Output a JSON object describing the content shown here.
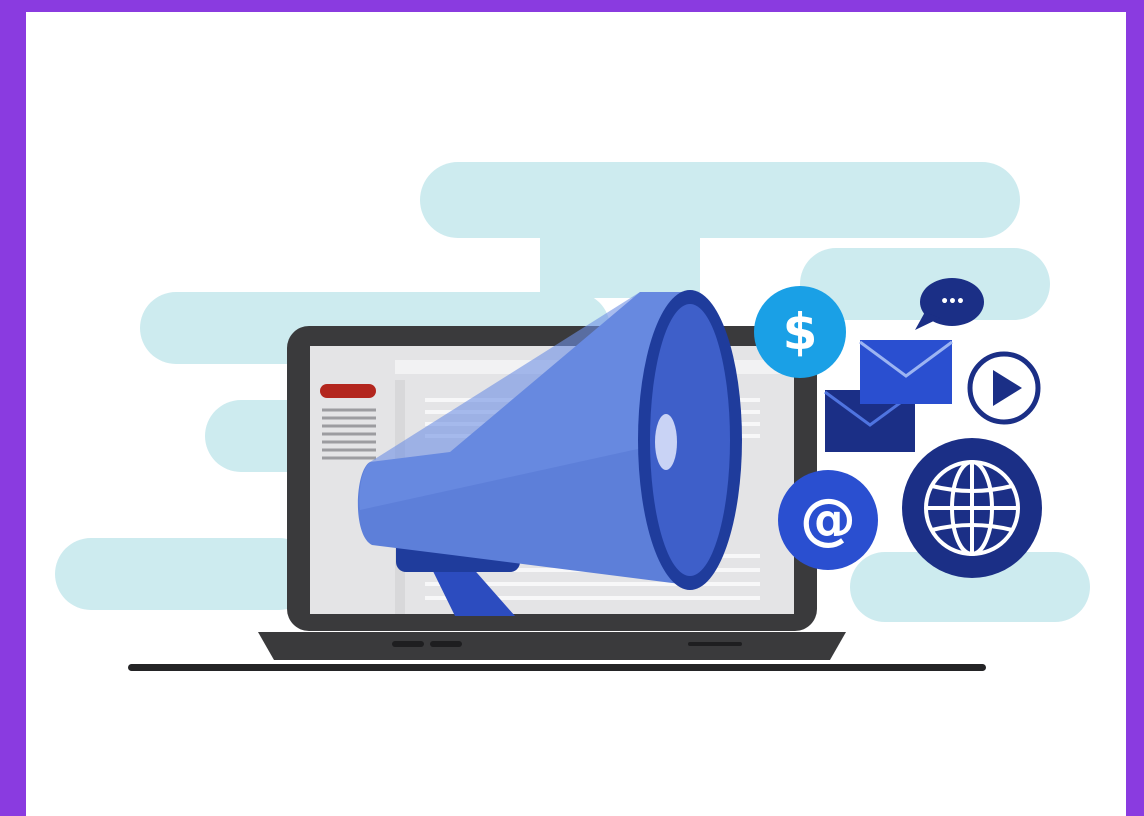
{
  "illustration": {
    "theme": "digital marketing",
    "colors": {
      "frame": "#8a3be0",
      "background": "#ffffff",
      "cloud": "#cdebef",
      "laptop_body": "#3a3a3c",
      "screen": "#e4e4e6",
      "accent_red": "#b3261e",
      "megaphone_light": "#5d7fd9",
      "megaphone_dark": "#1f3c9c",
      "icon_navy": "#1b2f86",
      "icon_sky": "#1aa0e6"
    },
    "icons": {
      "dollar": {
        "name": "dollar-icon",
        "glyph": "$"
      },
      "at": {
        "name": "at-sign-icon",
        "glyph": "@"
      },
      "chat": {
        "name": "chat-bubble-icon",
        "glyph": "•••"
      },
      "play": {
        "name": "play-icon",
        "glyph": "▶"
      },
      "globe": {
        "name": "globe-icon"
      },
      "mail": {
        "name": "envelope-icon"
      }
    }
  }
}
